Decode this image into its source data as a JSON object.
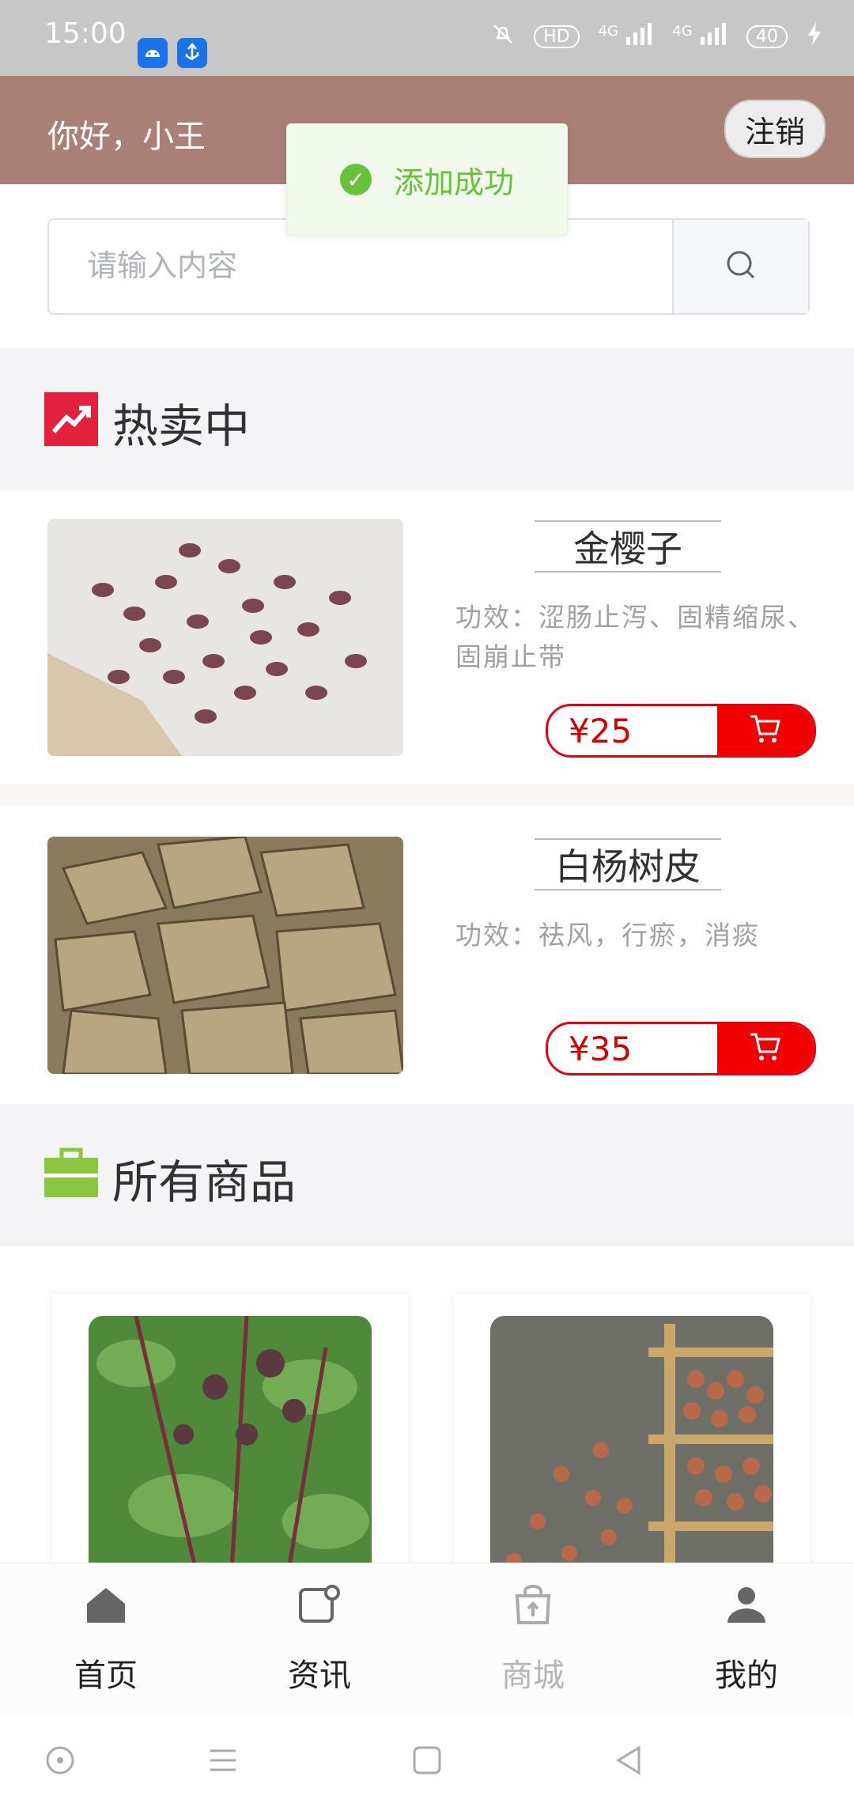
{
  "status_bar": {
    "time": "15:00",
    "net_1": "4G",
    "net_2": "4G",
    "battery": "40"
  },
  "header": {
    "greeting": "你好，小王",
    "logout_label": "注销"
  },
  "toast": {
    "message": "添加成功"
  },
  "search": {
    "placeholder": "请输入内容"
  },
  "hot_section": {
    "title": "热卖中",
    "icon": "trending-up-icon",
    "icon_color": "#e3213f",
    "items": [
      {
        "name": "金樱子",
        "desc": "功效：涩肠止泻、固精缩尿、固崩止带",
        "price": "¥25"
      },
      {
        "name": "白杨树皮",
        "desc": "功效：祛风，行瘀，消痰",
        "price": "¥35"
      }
    ]
  },
  "all_section": {
    "title": "所有商品",
    "icon": "briefcase-icon",
    "icon_color": "#8cc540"
  },
  "bottom_nav": {
    "items": [
      {
        "label": "首页",
        "icon": "home-icon"
      },
      {
        "label": "资讯",
        "icon": "news-icon"
      },
      {
        "label": "商城",
        "icon": "shop-bag-icon",
        "active": true
      },
      {
        "label": "我的",
        "icon": "user-icon"
      }
    ]
  },
  "colors": {
    "header_bg": "#a97f76",
    "price_red": "#e60012",
    "toast_green": "#67c23a"
  }
}
